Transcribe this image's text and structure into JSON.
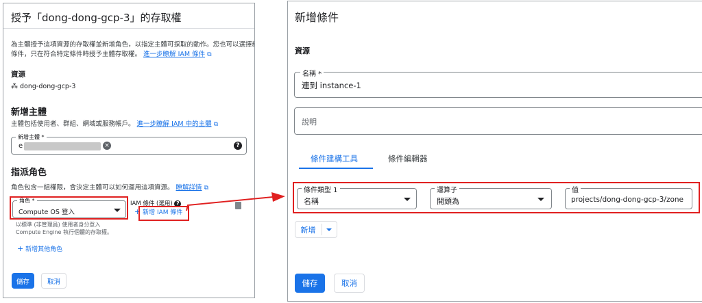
{
  "left": {
    "title": "授予「dong-dong-gcp-3」的存取權",
    "intro_line1": "為主體授予這項資源的存取權並新增角色，以指定主體可採取的動作。您也可以選擇新增",
    "intro_line2": "條件，只在符合特定條件時授予主體存取權。",
    "intro_link": "進一步瞭解 IAM 條件",
    "resource_heading": "資源",
    "resource_name": "dong-dong-gcp-3",
    "principal_heading": "新增主體",
    "principal_desc": "主體包括使用者、群組、網域或服務帳戶。",
    "principal_link": "進一步瞭解 IAM 中的主體",
    "principal_field_label": "新增主體 *",
    "principal_field_value": "e",
    "role_heading": "指派角色",
    "role_desc": "角色包含一組權限，會決定主體可以如何運用這項資源。",
    "role_link": "瞭解詳情",
    "role_field_label": "角色 *",
    "role_field_value": "Compute OS 登入",
    "role_help_line1": "以標準 (非管理員) 使用者身分登入",
    "role_help_line2": "Compute Engine 執行個體的存取權。",
    "iam_condition_label": "IAM 條件 (選用)",
    "add_iam_condition": "新增 IAM 條件",
    "add_other_role": "新增其他角色",
    "save": "儲存",
    "cancel": "取消"
  },
  "right": {
    "title": "新增條件",
    "section_title": "資源",
    "name_label": "名稱 *",
    "name_value": "連到 instance-1",
    "description_placeholder": "說明",
    "tabs": [
      "條件建構工具",
      "條件編輯器"
    ],
    "condition_type_label": "條件類型 1",
    "condition_type_value": "名稱",
    "operator_label": "運算子",
    "operator_value": "開頭為",
    "value_label": "值",
    "value_value": "projects/dong-dong-gcp-3/zone",
    "add": "新增",
    "save": "儲存",
    "cancel": "取消"
  },
  "colors": {
    "accent": "#1a73e8",
    "highlight": "#e02020",
    "text": "#202124",
    "muted": "#5f6368"
  }
}
